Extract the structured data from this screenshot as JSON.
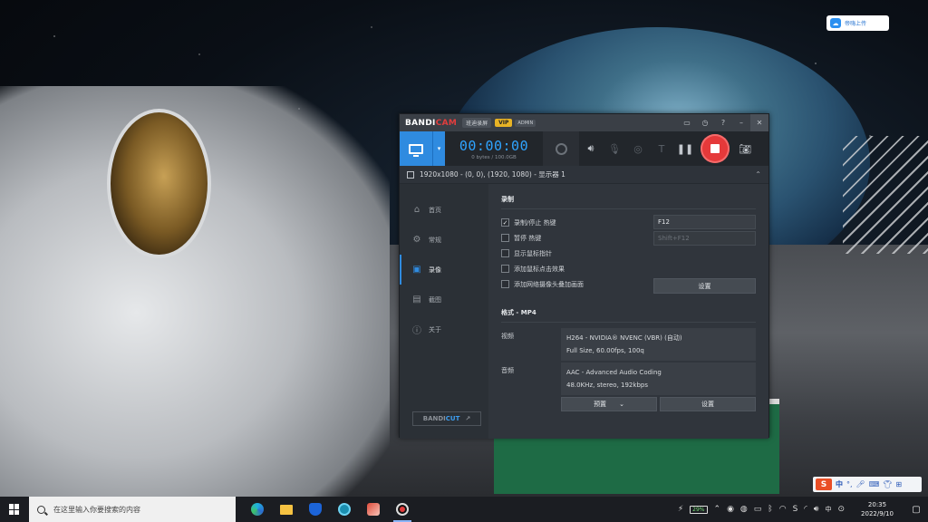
{
  "desktop": {
    "cloud_badge_label": "帝嗨上传"
  },
  "bandicam": {
    "title": {
      "logo_main": "BANDI",
      "logo_accent": "CAM",
      "mode_label": "班迪录屏",
      "vip_label": "VIP",
      "admin_label": "ADMIN",
      "controls": [
        "folder-icon",
        "clock-icon",
        "help-icon",
        "minimize-icon",
        "close-icon"
      ]
    },
    "toolbar": {
      "timer": "00:00:00",
      "file_size": "0 bytes / 100.0GB"
    },
    "capture_info": "1920x1080 - (0, 0), (1920, 1080) - 显示器 1",
    "sidebar": {
      "items": [
        {
          "label": "首页",
          "icon": "home-icon"
        },
        {
          "label": "常规",
          "icon": "gear-icon"
        },
        {
          "label": "录像",
          "icon": "video-icon"
        },
        {
          "label": "截图",
          "icon": "image-icon"
        },
        {
          "label": "关于",
          "icon": "info-icon"
        }
      ],
      "bandicut_main": "BANDI",
      "bandicut_accent": "CUT",
      "bandicut_arrow": "↗"
    },
    "record_section": {
      "title": "录制",
      "options": [
        {
          "label": "录制/停止 热键",
          "checked": true
        },
        {
          "label": "暂停 热键",
          "checked": false
        },
        {
          "label": "显示鼠标指针",
          "checked": false
        },
        {
          "label": "添加鼠标点击效果",
          "checked": false
        },
        {
          "label": "添加网络摄像头叠加画面",
          "checked": false
        }
      ],
      "hotkey_record": "F12",
      "hotkey_pause": "Shift+F12",
      "settings_button": "设置"
    },
    "format_section": {
      "title": "格式 - MP4",
      "video_label": "视频",
      "video_line1": "H264 - NVIDIA® NVENC (VBR) (自动)",
      "video_line2": "Full Size, 60.00fps, 100q",
      "audio_label": "音频",
      "audio_line1": "AAC - Advanced Audio Coding",
      "audio_line2": "48.0KHz, stereo, 192kbps",
      "preset_button": "预置",
      "settings_button": "设置"
    }
  },
  "ime": {
    "logo": "S",
    "lang": "中",
    "punct": "°,",
    "items": [
      "mic-icon",
      "keyboard-icon",
      "shirt-icon",
      "grid-icon"
    ]
  },
  "taskbar": {
    "search_placeholder": "在这里输入你要搜索的内容",
    "battery": "29%",
    "ime_lang": "中",
    "time": "20:35",
    "date": "2022/9/10"
  }
}
